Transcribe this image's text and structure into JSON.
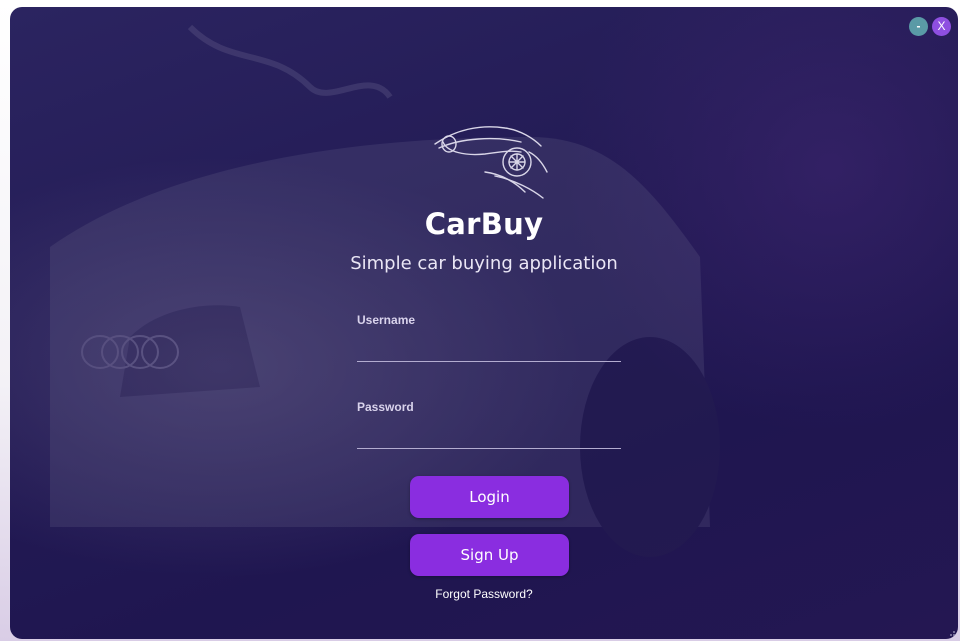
{
  "window": {
    "minimize_label": "-",
    "close_label": "X"
  },
  "brand": {
    "logo_icon": "sports-car-icon",
    "title": "CarBuy",
    "subtitle": "Simple car buying application"
  },
  "form": {
    "username_label": "Username",
    "username_value": "",
    "password_label": "Password",
    "password_value": "",
    "login_label": "Login",
    "signup_label": "Sign Up",
    "forgot_label": "Forgot Password?"
  },
  "colors": {
    "background": "#231b55",
    "accent": "#8a2de0",
    "minimize": "#5a9aa6",
    "close": "#8e4fe0"
  }
}
